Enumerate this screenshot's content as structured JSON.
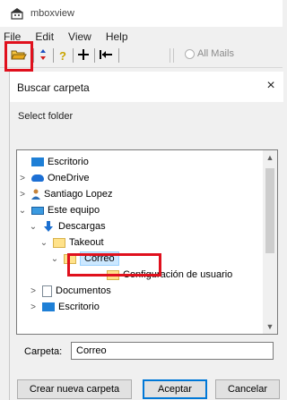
{
  "app": {
    "title": "mboxview"
  },
  "menu": [
    "File",
    "Edit",
    "View",
    "Help"
  ],
  "toolbar": {
    "all_mails_label": "All Mails"
  },
  "dialog": {
    "title": "Buscar carpeta",
    "instruction": "Select folder",
    "close_symbol": "×",
    "tree": [
      {
        "label": "Escritorio",
        "icon": "desktop-icon",
        "expander": "",
        "indent": 0
      },
      {
        "label": "OneDrive",
        "icon": "onedrive-icon",
        "expander": ">",
        "indent": 0
      },
      {
        "label": "Santiago Lopez",
        "icon": "user-icon",
        "expander": ">",
        "indent": 0
      },
      {
        "label": "Este equipo",
        "icon": "computer-icon",
        "expander": "v",
        "indent": 0
      },
      {
        "label": "Descargas",
        "icon": "download-icon",
        "expander": "v",
        "indent": 1
      },
      {
        "label": "Takeout",
        "icon": "folder-icon",
        "expander": "v",
        "indent": 2
      },
      {
        "label": "Correo",
        "icon": "folder-icon",
        "expander": "v",
        "indent": 3,
        "selected": true
      },
      {
        "label": "Configuración de usuario",
        "icon": "folder-icon",
        "expander": "",
        "indent": 4
      },
      {
        "label": "Documentos",
        "icon": "documents-icon",
        "expander": ">",
        "indent": 1
      },
      {
        "label": "Escritorio",
        "icon": "desktop-icon",
        "expander": ">",
        "indent": 1
      }
    ],
    "folder_label": "Carpeta:",
    "folder_value": "Correo",
    "buttons": {
      "new_folder": "Crear nueva carpeta",
      "accept": "Aceptar",
      "cancel": "Cancelar"
    }
  },
  "colors": {
    "highlight": "#e0101d",
    "selection": "#cce8ff",
    "folder": "#ffe28a",
    "accent": "#0078d7"
  }
}
